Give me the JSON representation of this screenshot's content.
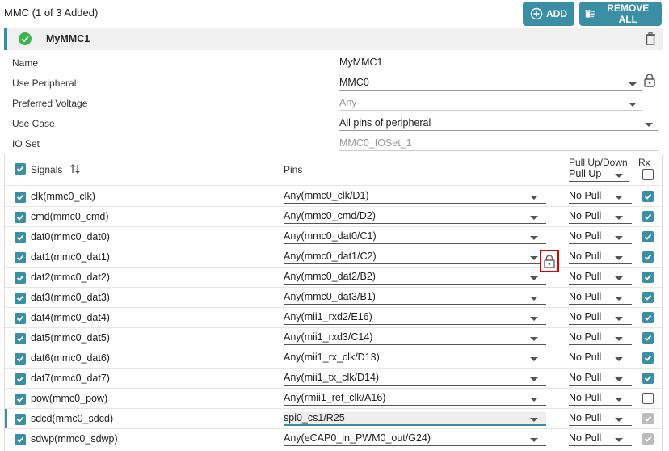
{
  "header": {
    "title": "MMC (1 of 3 Added)",
    "add_label": "ADD",
    "remove_all_label": "REMOVE ALL"
  },
  "instance": {
    "name": "MyMMC1"
  },
  "properties": [
    {
      "label": "Name",
      "value": "MyMMC1"
    },
    {
      "label": "Use Peripheral",
      "value": "MMC0"
    },
    {
      "label": "Preferred Voltage",
      "value": "Any"
    },
    {
      "label": "Use Case",
      "value": "All pins of peripheral"
    },
    {
      "label": "IO Set",
      "value": "MMC0_IOSet_1"
    }
  ],
  "grid": {
    "signals_header": "Signals",
    "pins_header": "Pins",
    "pull_header": "Pull Up/Down",
    "pull_header_value": "Pull Up",
    "rx_header": "Rx",
    "rows": [
      {
        "signal": "clk(mmc0_clk)",
        "pin": "Any(mmc0_clk/D1)",
        "pull": "No Pull",
        "rx": true
      },
      {
        "signal": "cmd(mmc0_cmd)",
        "pin": "Any(mmc0_cmd/D2)",
        "pull": "No Pull",
        "rx": true
      },
      {
        "signal": "dat0(mmc0_dat0)",
        "pin": "Any(mmc0_dat0/C1)",
        "pull": "No Pull",
        "rx": true
      },
      {
        "signal": "dat1(mmc0_dat1)",
        "pin": "Any(mmc0_dat1/C2)",
        "pull": "No Pull",
        "rx": true
      },
      {
        "signal": "dat2(mmc0_dat2)",
        "pin": "Any(mmc0_dat2/B2)",
        "pull": "No Pull",
        "rx": true
      },
      {
        "signal": "dat3(mmc0_dat3)",
        "pin": "Any(mmc0_dat3/B1)",
        "pull": "No Pull",
        "rx": true
      },
      {
        "signal": "dat4(mmc0_dat4)",
        "pin": "Any(mii1_rxd2/E16)",
        "pull": "No Pull",
        "rx": true
      },
      {
        "signal": "dat5(mmc0_dat5)",
        "pin": "Any(mii1_rxd3/C14)",
        "pull": "No Pull",
        "rx": true
      },
      {
        "signal": "dat6(mmc0_dat6)",
        "pin": "Any(mii1_rx_clk/D13)",
        "pull": "No Pull",
        "rx": true
      },
      {
        "signal": "dat7(mmc0_dat7)",
        "pin": "Any(mii1_tx_clk/D14)",
        "pull": "No Pull",
        "rx": true
      },
      {
        "signal": "pow(mmc0_pow)",
        "pin": "Any(rmii1_ref_clk/A16)",
        "pull": "No Pull",
        "rx": false
      },
      {
        "signal": "sdcd(mmc0_sdcd)",
        "pin": "spi0_cs1/R25",
        "pull": "No Pull",
        "rx": "disabled"
      },
      {
        "signal": "sdwp(mmc0_sdwp)",
        "pin": "Any(eCAP0_in_PWM0_out/G24)",
        "pull": "No Pull",
        "rx": "disabled"
      }
    ]
  },
  "colors": {
    "accent": "#3a8fa4",
    "highlight": "#e00000",
    "success": "#3bb54a"
  }
}
